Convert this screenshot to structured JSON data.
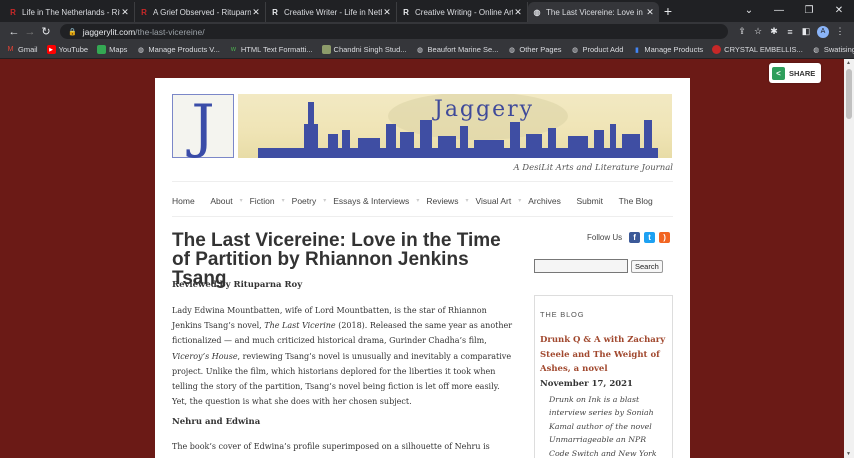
{
  "browser": {
    "tabs": [
      {
        "label": "Life in The Netherlands - Rituparna",
        "icon": "R"
      },
      {
        "label": "A Grief Observed - Rituparna Roy",
        "icon": "R"
      },
      {
        "label": "Creative Writer - Life in Netherlands",
        "icon": "R"
      },
      {
        "label": "Creative Writing - Online Articles",
        "icon": "R"
      },
      {
        "label": "The Last Vicereine: Love in the Time",
        "icon": "globe"
      }
    ],
    "new_tab": "+",
    "url_host": "jaggerylit.com",
    "url_path": "/the-last-vicereine/",
    "profile_initial": "A",
    "bookmarks": [
      "Gmail",
      "YouTube",
      "Maps",
      "Manage Products V...",
      "HTML Text Formatti...",
      "Chandni Singh Stud...",
      "Beaufort Marine Se...",
      "Other Pages",
      "Product Add",
      "Manage Products",
      "CRYSTAL EMBELLIS...",
      "Swatisinghlabel.com"
    ],
    "bookmarks_more": "»"
  },
  "share": {
    "label": "SHARE"
  },
  "site": {
    "logo_letter": "J",
    "banner_title": "Jaggery",
    "tagline": "A DesiLit Arts and Literature Journal",
    "menu": [
      "Home",
      "About",
      "Fiction",
      "Poetry",
      "Essays & Interviews",
      "Reviews",
      "Visual Art",
      "Archives",
      "Submit",
      "The Blog"
    ],
    "menu_has_dropdown": [
      false,
      true,
      true,
      true,
      true,
      true,
      true,
      false,
      false,
      false
    ]
  },
  "article": {
    "title": "The Last Vicereine: Love in the Time of Partition by Rhiannon Jenkins Tsang",
    "byline": "Reviewed by Rituparna Roy",
    "p1_a": "Lady Edwina Mountbatten, wife of Lord Mountbatten, is the star of Rhiannon Jenkins Tsang’s novel, ",
    "p1_b": "The Last Vicerine",
    "p1_c": " (2018). Released the same year as another fictionalized — and much criticized historical drama, Gurinder Chadha’s film, ",
    "p1_d": "Viceroy’s House",
    "p1_e": ", reviewing Tsang’s novel is unusually and inevitably a comparative project. Unlike the film, which historians deplored for the liberties it took when telling the story of the partition, Tsang’s novel being fiction is let off more easily. Yet, the question is what she does with her chosen subject.",
    "subhead": "Nehru and Edwina",
    "p2": "The book’s cover of Edwina’s profile superimposed on a silhouette of Nehru is evocative;"
  },
  "sidebar": {
    "follow_label": "Follow Us",
    "social": [
      "facebook-icon",
      "twitter-icon",
      "rss-icon"
    ],
    "search_placeholder": "",
    "search_button": "Search",
    "blog_heading": "THE BLOG",
    "post_title": "Drunk Q & A with Zachary Steele and The Weight of Ashes, a novel",
    "post_date": "November 17, 2021",
    "post_excerpt": "Drunk on Ink is a blast interview series by Soniah Kamal author of the novel Unmarriageable an NPR Code Switch and New York Public Library Summer"
  },
  "colors": {
    "page_bg": "#6b1a16",
    "link": "#a1482e",
    "brand_blue": "#3a4ca8"
  }
}
